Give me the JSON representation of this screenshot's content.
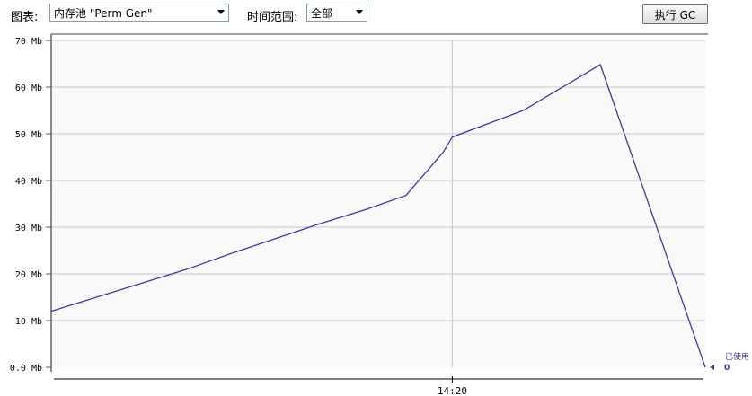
{
  "toolbar": {
    "chart_label": "图表:",
    "chart_select_value": "内存池 \"Perm Gen\"",
    "time_range_label": "时间范围:",
    "time_range_value": "全部",
    "gc_button": "执行 GC"
  },
  "chart_data": {
    "type": "line",
    "title": "",
    "xlabel": "",
    "ylabel": "",
    "ylim": [
      0,
      70
    ],
    "yticks": [
      0,
      10,
      20,
      30,
      40,
      50,
      60,
      70
    ],
    "ytick_labels": [
      "0.0 Mb",
      "10 Mb",
      "20 Mb",
      "30 Mb",
      "40 Mb",
      "50 Mb",
      "60 Mb",
      "70 Mb"
    ],
    "x_range_minutes": [
      -6.5,
      4.1
    ],
    "xticks": [
      {
        "x": 0,
        "label": "14:20"
      }
    ],
    "grid": true,
    "series": [
      {
        "name": "已使用",
        "color": "#3b3b9a",
        "x": [
          -6.5,
          -4.3,
          -3.6,
          -2.2,
          -1.4,
          -0.75,
          -0.15,
          0.0,
          1.15,
          2.4,
          4.1
        ],
        "y": [
          12,
          21,
          24.3,
          30.5,
          33.8,
          36.8,
          46,
          49.3,
          55,
          64.8,
          0
        ]
      }
    ],
    "legend": {
      "position": "right",
      "entries": [
        {
          "label": "已使用",
          "value": "0"
        }
      ]
    },
    "colors": {
      "line": "#3b3b9a",
      "plot_bg": "#f9f9f9",
      "grid": "#c8c8c8",
      "axis": "#606060"
    }
  }
}
